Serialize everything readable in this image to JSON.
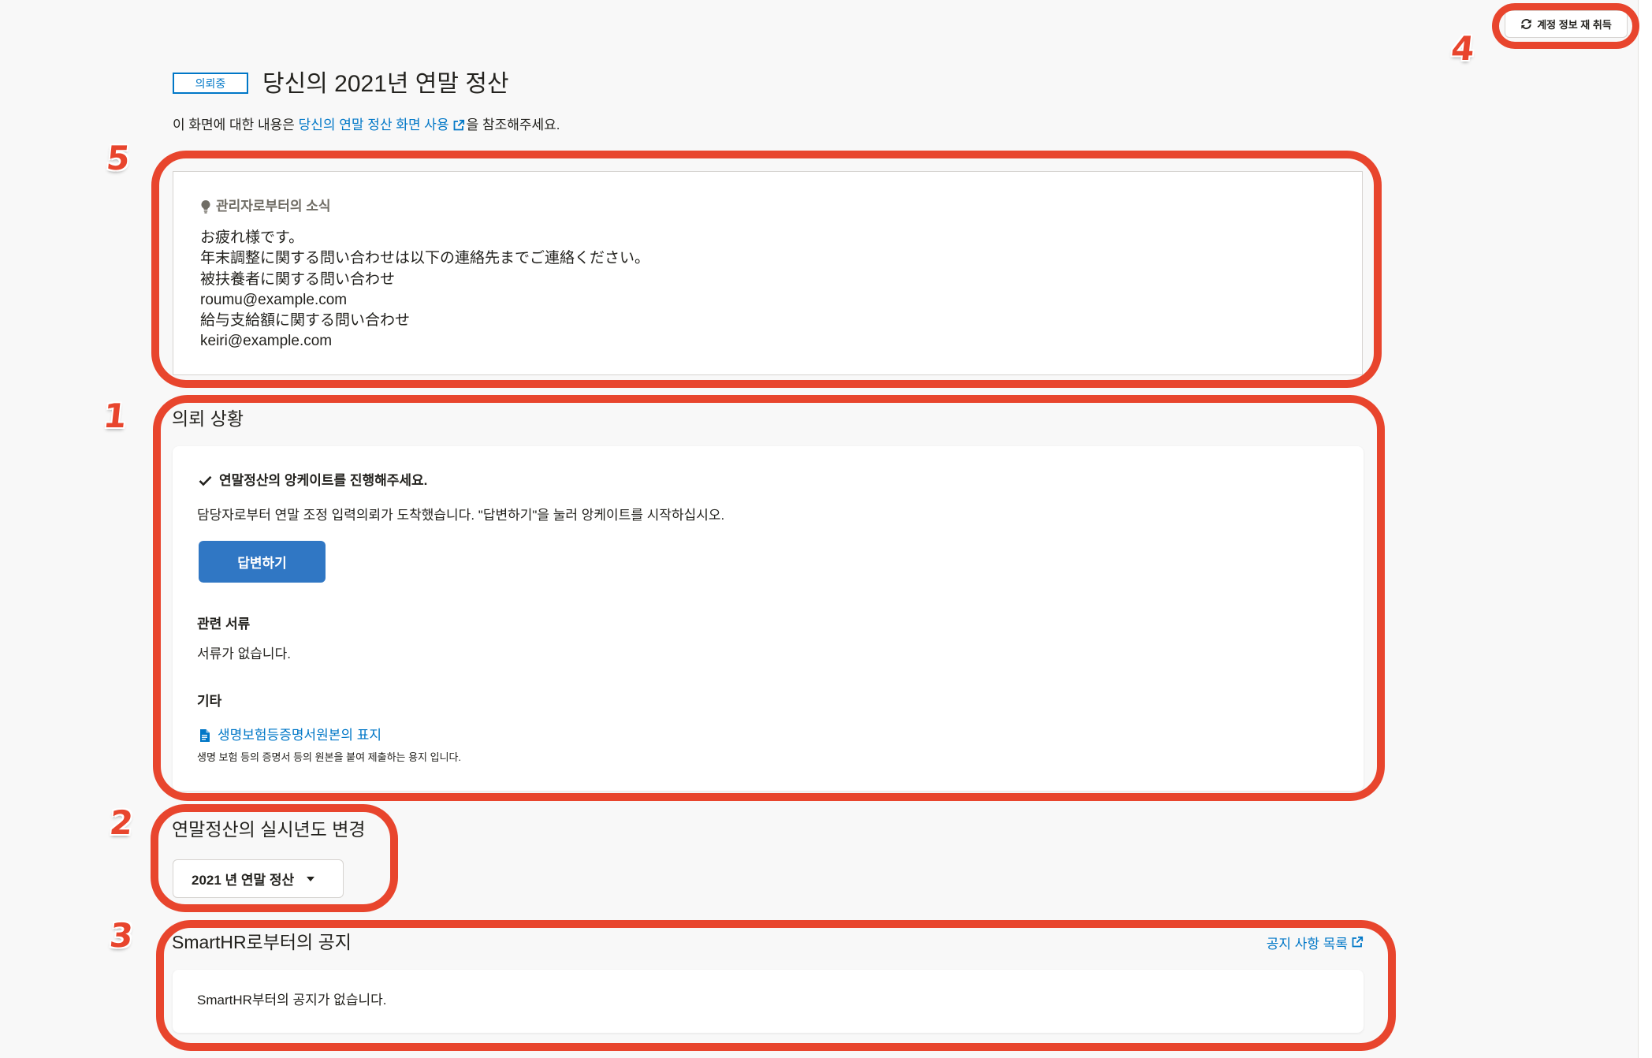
{
  "header": {
    "refresh_button_label": "계정 정보 재 취득",
    "status_badge": "의뢰중",
    "title": "당신의 2021년 연말 정산",
    "help_prefix": "이 화면에 대한 내용은 ",
    "help_link": "당신의 연말 정산 화면 사용",
    "help_suffix": "을 참조해주세요."
  },
  "admin_notice": {
    "heading": "관리자로부터의 소식",
    "lines": [
      "お疲れ様です。",
      "年末調整に関する問い合わせは以下の連絡先までご連絡ください。",
      "被扶養者に関する問い合わせ",
      "roumu@example.com",
      "給与支給額に関する問い合わせ",
      "keiri@example.com"
    ]
  },
  "request_status": {
    "heading": "의뢰 상황",
    "task_title": "연말정산의 앙케이트를 진행해주세요.",
    "task_description": "담당자로부터 연말 조정 입력의뢰가 도착했습니다. \"답변하기\"을 눌러 앙케이트를 시작하십시오.",
    "answer_button": "답변하기",
    "related_docs_heading": "관련 서류",
    "related_docs_empty": "서류가 없습니다.",
    "other_heading": "기타",
    "other_link": "생명보험등증명서원본의 표지",
    "other_link_description": "생명 보험 등의 증명서 등의 원본을 붙여 제출하는 용지 입니다."
  },
  "year_change": {
    "heading": "연말정산의 실시년도 변경",
    "selected": "2021 년 연말 정산"
  },
  "notices": {
    "heading": "SmartHR로부터의 공지",
    "list_link": "공지 사항 목록",
    "empty": "SmartHR부터의 공지가 없습니다."
  },
  "annotations": {
    "request_status": "1",
    "year_change": "2",
    "notices": "3",
    "refresh": "4",
    "admin_notice": "5"
  },
  "icons": {
    "refresh": "refresh-icon",
    "external": "external-link-icon",
    "notice": "lightbulb-icon",
    "task": "check-icon",
    "document": "document-icon",
    "select": "caret-down-icon"
  },
  "colors": {
    "accent": "#0077c7",
    "primary_button": "#3077c4",
    "annotation": "#e8452d",
    "background": "#f8f8f8",
    "text": "#23221e"
  }
}
